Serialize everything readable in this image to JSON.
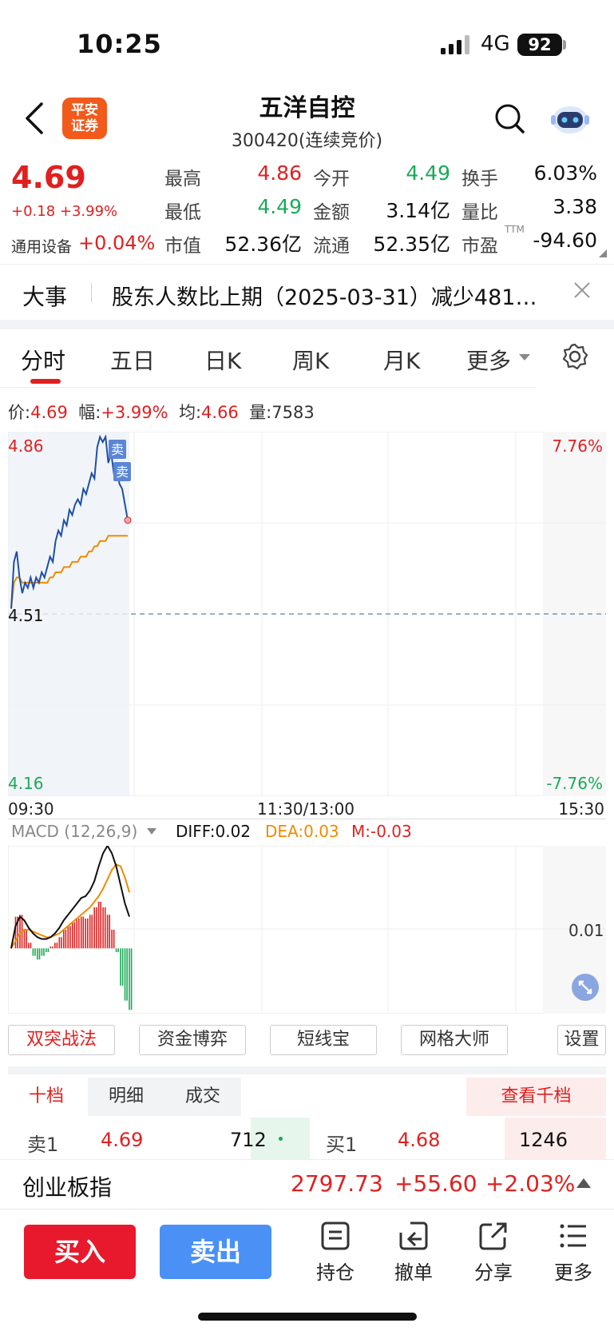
{
  "status_bar": {
    "time": "10:25",
    "network": "4G",
    "battery": "92"
  },
  "header": {
    "logo_line1": "平安",
    "logo_line2": "证券",
    "stock_name": "五洋自控",
    "stock_code": "300420(连续竞价)"
  },
  "quote": {
    "price": "4.69",
    "change": "+0.18 +3.99%",
    "sector_name": "通用设备",
    "sector_change": "+0.04%",
    "ttm_label": "TTM",
    "cells": [
      {
        "label": "最高",
        "value": "4.86",
        "color": "#e02020"
      },
      {
        "label": "今开",
        "value": "4.49",
        "color": "#1aaa55"
      },
      {
        "label": "换手",
        "value": "6.03%",
        "color": "#111111"
      },
      {
        "label": "最低",
        "value": "4.49",
        "color": "#1aaa55"
      },
      {
        "label": "金额",
        "value": "3.14亿",
        "color": "#111111"
      },
      {
        "label": "量比",
        "value": "3.38",
        "color": "#111111"
      },
      {
        "label": "市值",
        "value": "52.36亿",
        "color": "#111111"
      },
      {
        "label": "流通",
        "value": "52.35亿",
        "color": "#111111"
      },
      {
        "label": "市盈",
        "value": "-94.60",
        "color": "#111111"
      }
    ]
  },
  "news": {
    "tag": "大事",
    "text": "股东人数比上期（2025-03-31）减少481…"
  },
  "tabs": [
    {
      "label": "分时",
      "active": true
    },
    {
      "label": "五日"
    },
    {
      "label": "日K"
    },
    {
      "label": "周K"
    },
    {
      "label": "月K"
    },
    {
      "label": "更多"
    }
  ],
  "info_row": {
    "price_label": "价:",
    "price": "4.69",
    "amp_label": "幅:",
    "amp": "+3.99%",
    "avg_label": "均:",
    "avg": "4.66",
    "vol_label": "量:",
    "vol": "7583"
  },
  "chart_data": [
    {
      "type": "line",
      "title": "",
      "x_ticks": [
        "09:30",
        "11:30/13:00",
        "15:30"
      ],
      "y_ticks_left": [
        "4.86",
        "4.51",
        "4.16"
      ],
      "y_ticks_right": [
        "7.76%",
        "-7.76%"
      ],
      "ylim": [
        4.16,
        4.86
      ],
      "prev_close": 4.51,
      "sell_markers": [
        "卖",
        "卖"
      ],
      "series": [
        {
          "values": [
            4.52,
            4.61,
            4.63,
            4.58,
            4.55,
            4.57,
            4.56,
            4.58,
            4.56,
            4.58,
            4.57,
            4.59,
            4.58,
            4.6,
            4.62,
            4.61,
            4.65,
            4.67,
            4.66,
            4.69,
            4.68,
            4.71,
            4.7,
            4.72,
            4.73,
            4.72,
            4.75,
            4.74,
            4.76,
            4.78,
            4.77,
            4.83,
            4.85,
            4.84,
            4.85,
            4.8,
            4.82,
            4.78,
            4.79,
            4.76,
            4.75,
            4.72,
            4.69
          ]
        },
        {
          "values": [
            4.52,
            4.57,
            4.58,
            4.58,
            4.57,
            4.57,
            4.57,
            4.57,
            4.57,
            4.57,
            4.57,
            4.57,
            4.57,
            4.57,
            4.58,
            4.58,
            4.59,
            4.59,
            4.59,
            4.6,
            4.6,
            4.6,
            4.61,
            4.61,
            4.61,
            4.62,
            4.62,
            4.62,
            4.63,
            4.63,
            4.64,
            4.64,
            4.65,
            4.65,
            4.65,
            4.66,
            4.66,
            4.66,
            4.66,
            4.66,
            4.66,
            4.66,
            4.66
          ]
        }
      ]
    },
    {
      "type": "bar",
      "title": "MACD (12,26,9)",
      "ylim": [
        -0.035,
        0.055
      ],
      "y_ticks": [
        "0.01"
      ],
      "series": [
        {
          "name": "DIFF",
          "values": [
            0.0,
            0.012,
            0.017,
            0.015,
            0.011,
            0.008,
            0.006,
            0.005,
            0.005,
            0.006,
            0.008,
            0.011,
            0.015,
            0.018,
            0.021,
            0.024,
            0.027,
            0.028,
            0.031,
            0.036,
            0.044,
            0.051,
            0.055,
            0.051,
            0.044,
            0.034,
            0.024,
            0.017
          ]
        },
        {
          "name": "DEA",
          "values": [
            0.0,
            0.004,
            0.008,
            0.01,
            0.01,
            0.009,
            0.008,
            0.007,
            0.006,
            0.006,
            0.007,
            0.008,
            0.01,
            0.012,
            0.014,
            0.016,
            0.018,
            0.02,
            0.022,
            0.025,
            0.028,
            0.032,
            0.037,
            0.042,
            0.045,
            0.044,
            0.038,
            0.03
          ]
        },
        {
          "name": "M",
          "values": [
            0.0,
            0.017,
            0.018,
            0.01,
            0.003,
            -0.004,
            -0.006,
            -0.004,
            -0.002,
            0.001,
            0.003,
            0.006,
            0.01,
            0.012,
            0.014,
            0.016,
            0.017,
            0.016,
            0.018,
            0.022,
            0.025,
            0.022,
            0.018,
            0.01,
            -0.002,
            -0.02,
            -0.028,
            -0.033
          ]
        }
      ]
    }
  ],
  "macd_legend": {
    "title": "MACD (12,26,9)",
    "diff": "DIFF:0.02",
    "dea": "DEA:0.03",
    "m": "M:-0.03"
  },
  "tools": [
    "双突战法",
    "资金博弈",
    "短线宝",
    "网格大师",
    "设置"
  ],
  "order_book": {
    "tabs": [
      "十档",
      "明细",
      "成交"
    ],
    "thousand_btn": "查看千档",
    "sell_label": "卖1",
    "sell_price": "4.69",
    "sell_vol": "712",
    "buy_label": "买1",
    "buy_price": "4.68",
    "buy_vol": "1246"
  },
  "index_bar": {
    "name": "创业板指",
    "value": "2797.73",
    "change": "+55.60",
    "pct": "+2.03%"
  },
  "bottom": {
    "buy": "买入",
    "sell": "卖出",
    "actions": [
      {
        "label": "持仓",
        "icon": "document-icon"
      },
      {
        "label": "撤单",
        "icon": "undo-icon"
      },
      {
        "label": "分享",
        "icon": "share-icon"
      },
      {
        "label": "更多",
        "icon": "menu-icon"
      }
    ]
  },
  "colors": {
    "up": "#e02020",
    "down": "#1aaa55",
    "price_line": "#1f4fa8",
    "avg_line": "#f08a00",
    "buy": "#e8192c",
    "sell": "#4a90f5"
  }
}
